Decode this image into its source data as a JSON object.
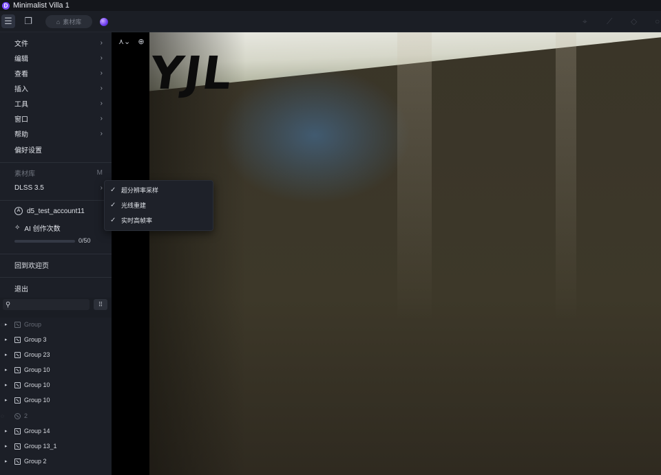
{
  "window": {
    "title": "Minimalist Villa 1"
  },
  "toolbar": {
    "library_label": "素材库"
  },
  "menu": {
    "items": [
      {
        "label": "文件"
      },
      {
        "label": "编辑"
      },
      {
        "label": "查看"
      },
      {
        "label": "插入"
      },
      {
        "label": "工具"
      },
      {
        "label": "窗口"
      },
      {
        "label": "帮助"
      }
    ],
    "preferences": "偏好设置",
    "library": {
      "label": "素材库",
      "shortcut": "M"
    },
    "dlss": "DLSS 3.5",
    "account": "d5_test_account11",
    "ai_label": "AI 创作次数",
    "ai_progress_text": "0/50",
    "ai_progress_fraction": 0,
    "welcome": "回到欢迎页",
    "exit": "退出"
  },
  "dlss_submenu": [
    {
      "label": "超分辨率采样",
      "checked": true
    },
    {
      "label": "光线重建",
      "checked": true
    },
    {
      "label": "实时高帧率",
      "checked": true
    }
  ],
  "scene_tree": [
    {
      "label": "Group",
      "muted": true
    },
    {
      "label": "Group 3"
    },
    {
      "label": "Group 23"
    },
    {
      "label": "Group 10"
    },
    {
      "label": "Group 10"
    },
    {
      "label": "Group 10"
    },
    {
      "label": "2",
      "muted": true
    },
    {
      "label": "Group 14"
    },
    {
      "label": "Group 13_1"
    },
    {
      "label": "Group 2"
    }
  ],
  "colors": {
    "accent": "#7a4cff",
    "panel": "#1c1f27"
  }
}
